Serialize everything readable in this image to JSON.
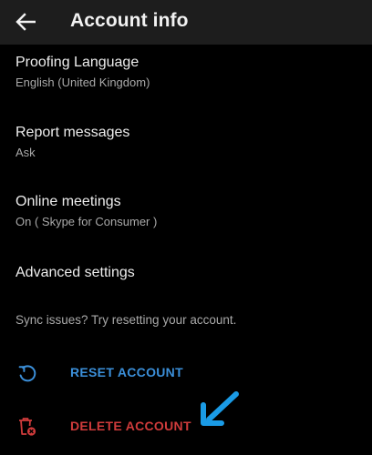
{
  "header": {
    "title": "Account info",
    "back_icon": "arrow-left-icon"
  },
  "settings": [
    {
      "title": "Proofing Language",
      "value": "English (United Kingdom)"
    },
    {
      "title": "Report messages",
      "value": "Ask"
    },
    {
      "title": "Online meetings",
      "value": "On ( Skype for Consumer )"
    },
    {
      "title": "Advanced settings"
    }
  ],
  "sync_hint": "Sync issues? Try resetting your account.",
  "actions": {
    "reset": {
      "label": "RESET ACCOUNT",
      "icon": "refresh-icon",
      "color": "#3b8fd9"
    },
    "delete": {
      "label": "DELETE ACCOUNT",
      "icon": "trash-x-icon",
      "color": "#cf3b3b"
    }
  },
  "annotation": {
    "icon": "arrow-pointer-icon",
    "color": "#1a9be6"
  }
}
